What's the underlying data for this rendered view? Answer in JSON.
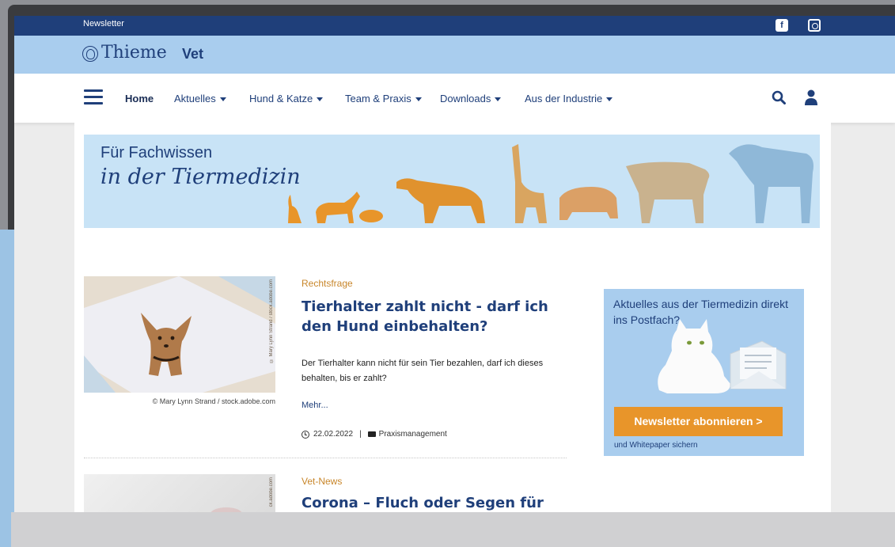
{
  "topbar": {
    "newsletter_link": "Newsletter",
    "social_icons": [
      "facebook-icon",
      "instagram-icon"
    ]
  },
  "brand": {
    "name": "Thieme",
    "sub": "Vet"
  },
  "nav": {
    "items": [
      {
        "label": "Home",
        "active": true,
        "dropdown": false
      },
      {
        "label": "Aktuelles",
        "dropdown": true
      },
      {
        "label": "Hund & Katze",
        "dropdown": true
      },
      {
        "label": "Team & Praxis",
        "dropdown": true
      },
      {
        "label": "Downloads",
        "dropdown": true
      },
      {
        "label": "Aus der Industrie",
        "dropdown": true
      }
    ],
    "icons": [
      "menu-icon",
      "search-icon",
      "user-icon"
    ]
  },
  "banner": {
    "line1": "Für Fachwissen",
    "line2": "in der Tiermedizin"
  },
  "articles": [
    {
      "category": "Rechtsfrage",
      "title": "Tierhalter zahlt nicht - darf ich den Hund einbehalten?",
      "excerpt": "Der Tierhalter kann nicht für sein Tier bezahlen, darf ich dieses behalten, bis er zahlt?",
      "more": "Mehr...",
      "date": "22.02.2022",
      "section": "Praxismanagement",
      "image_credit": "© Mary Lynn Strand / stock.adobe.com",
      "image_vertical_credit": "© Mary Lynn Strand / stock.adobe.com"
    },
    {
      "category": "Vet-News",
      "title": "Corona – Fluch oder Segen für die",
      "image_vertical_credit": "ck.adobe.com"
    }
  ],
  "newsletter_box": {
    "headline": "Aktuelles aus der Tiermedizin direkt ins Postfach?",
    "button": "Newsletter abonnieren >",
    "note": "und Whitepaper sichern"
  },
  "colors": {
    "navy": "#1f3f7a",
    "light_blue": "#a9cdee",
    "orange": "#e8952a",
    "category": "#c8862a"
  }
}
